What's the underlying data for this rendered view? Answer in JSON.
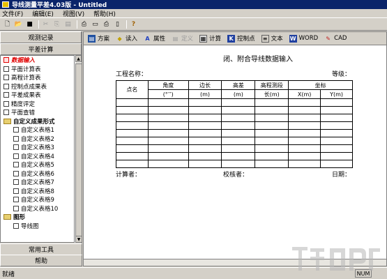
{
  "window": {
    "title": "导线测量平差4.03版 - Untitled"
  },
  "menu": [
    "文件(F)",
    "编辑(E)",
    "视图(V)",
    "帮助(H)"
  ],
  "sidebar": {
    "header_top": "观测记录",
    "header_sub": "平差计算",
    "items": [
      {
        "label": "数据输入",
        "kind": "check",
        "active": true
      },
      {
        "label": "平面计算表",
        "kind": "check"
      },
      {
        "label": "高程计算表",
        "kind": "check"
      },
      {
        "label": "控制点成果表",
        "kind": "check"
      },
      {
        "label": "平差成果表",
        "kind": "check"
      },
      {
        "label": "精度评定",
        "kind": "check"
      },
      {
        "label": "平面查错",
        "kind": "check"
      },
      {
        "label": "自定义成果形式",
        "kind": "folder"
      },
      {
        "label": "自定义表格1",
        "kind": "check",
        "indent": 1
      },
      {
        "label": "自定义表格2",
        "kind": "check",
        "indent": 1
      },
      {
        "label": "自定义表格3",
        "kind": "check",
        "indent": 1
      },
      {
        "label": "自定义表格4",
        "kind": "check",
        "indent": 1
      },
      {
        "label": "自定义表格5",
        "kind": "check",
        "indent": 1
      },
      {
        "label": "自定义表格6",
        "kind": "check",
        "indent": 1
      },
      {
        "label": "自定义表格7",
        "kind": "check",
        "indent": 1
      },
      {
        "label": "自定义表格8",
        "kind": "check",
        "indent": 1
      },
      {
        "label": "自定义表格9",
        "kind": "check",
        "indent": 1
      },
      {
        "label": "自定义表格10",
        "kind": "check",
        "indent": 1
      },
      {
        "label": "图形",
        "kind": "folder"
      },
      {
        "label": "导线图",
        "kind": "check",
        "indent": 1
      }
    ],
    "footer_tools": "常用工具",
    "footer_help": "帮助"
  },
  "main_toolbar": [
    {
      "label": "方案",
      "icon": "plan-icon"
    },
    {
      "label": "读入",
      "icon": "read-icon"
    },
    {
      "label": "属性",
      "icon": "properties-icon"
    },
    {
      "label": "定义",
      "icon": "define-icon",
      "disabled": true
    },
    {
      "label": "计算",
      "icon": "calc-icon"
    },
    {
      "label": "控制点",
      "icon": "K",
      "glyph": "K"
    },
    {
      "label": "文本",
      "icon": "text-icon"
    },
    {
      "label": "WORD",
      "icon": "word-icon",
      "glyph": "W"
    },
    {
      "label": "CAD",
      "icon": "cad-icon"
    }
  ],
  "form": {
    "title": "闭、附合导线数据输入",
    "project_label": "工程名称：",
    "grade_label": "等级：",
    "headers": {
      "point": "点名",
      "angle": "角度",
      "angle_unit": "(°′″)",
      "side": "边长",
      "side_unit": "(m)",
      "height_diff": "高差",
      "height_diff_unit": "(m)",
      "leveling_len": "高程测段",
      "leveling_unit": "长(m)",
      "coord": "坐标",
      "x": "X(m)",
      "y": "Y(m)"
    },
    "calc_label": "计算者：",
    "check_label": "校核者：",
    "date_label": "日期："
  },
  "status": {
    "text": "就绪",
    "num": "NUM"
  }
}
